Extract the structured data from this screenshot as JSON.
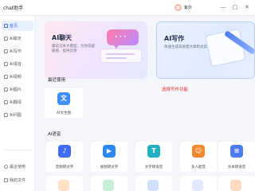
{
  "app": {
    "title": "chat助手"
  },
  "header": {
    "user_name": "紫外",
    "minimize_glyph": "—",
    "maximize_glyph": "□",
    "close_glyph": "✕"
  },
  "sidebar": {
    "items": [
      {
        "label": "首页",
        "icon": "home-icon",
        "active": true
      },
      {
        "label": "AI聊天",
        "icon": "chat-icon",
        "active": false
      },
      {
        "label": "AI写作",
        "icon": "write-icon",
        "active": false
      },
      {
        "label": "AI语音",
        "icon": "voice-icon",
        "active": false
      },
      {
        "label": "AI视频",
        "icon": "video-icon",
        "active": false
      },
      {
        "label": "AI图片",
        "icon": "image-icon",
        "active": false
      },
      {
        "label": "AI翻译",
        "icon": "translate-icon",
        "active": false
      },
      {
        "label": "AI问图",
        "icon": "image-question-icon",
        "active": false
      }
    ],
    "bottom_items": [
      {
        "label": "最近使用",
        "icon": "clock-icon"
      },
      {
        "label": "我的文件",
        "icon": "folder-icon"
      }
    ]
  },
  "banners": [
    {
      "title": "AI聊天",
      "description": "最前沿本大模型，为你答疑解惑、提供灵感"
    },
    {
      "title": "AI写作",
      "description": "快速生成高质量文章和文案"
    }
  ],
  "annotation": "选择写作功能",
  "recent": {
    "title": "最近使用",
    "items": [
      {
        "label": "AI文生图",
        "glyph": "文",
        "icon": "text-to-image-icon",
        "color": "#3f8df5"
      }
    ]
  },
  "voice": {
    "title": "AI语音",
    "tools": [
      {
        "label": "音频转文字",
        "glyph": "♪",
        "icon": "audio-to-text-icon",
        "color": "#3f6cf0"
      },
      {
        "label": "视频转文字",
        "glyph": "▶",
        "icon": "video-to-text-icon",
        "color": "#2f86f6"
      },
      {
        "label": "文字转语音",
        "glyph": "T",
        "icon": "text-to-speech-icon",
        "color": "#21b0c4"
      },
      {
        "label": "多人配音",
        "glyph": "☺",
        "icon": "multi-dubbing-icon",
        "color": "#f08a2a"
      },
      {
        "label": "文本转语音",
        "glyph": "≡",
        "icon": "text-audio-icon",
        "color": "#4c7cf3"
      }
    ]
  },
  "colors": {
    "accent": "#3f6cf0",
    "annotation": "#e0302a"
  }
}
